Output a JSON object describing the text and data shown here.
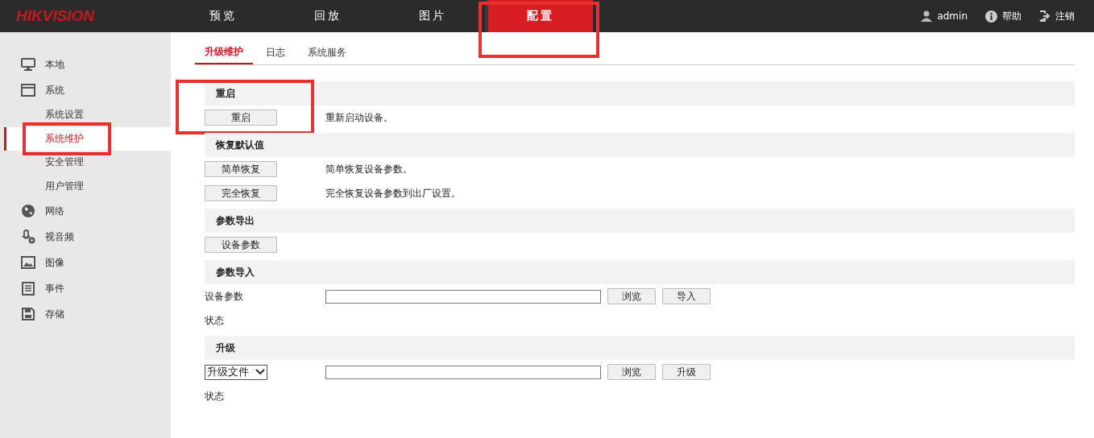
{
  "header": {
    "logo": "HIKVISION",
    "nav": [
      {
        "label": "预览",
        "selected": false
      },
      {
        "label": "回放",
        "selected": false
      },
      {
        "label": "图片",
        "selected": false
      },
      {
        "label": "配置",
        "selected": true,
        "highlighted": true
      }
    ],
    "user": "admin",
    "help": "帮助",
    "logout": "注销"
  },
  "sidebar": {
    "items": [
      {
        "label": "本地"
      },
      {
        "label": "系统",
        "children": [
          {
            "label": "系统设置",
            "selected": false
          },
          {
            "label": "系统维护",
            "selected": true,
            "highlighted": true
          },
          {
            "label": "安全管理",
            "selected": false
          },
          {
            "label": "用户管理",
            "selected": false
          }
        ]
      },
      {
        "label": "网络"
      },
      {
        "label": "视音频"
      },
      {
        "label": "图像"
      },
      {
        "label": "事件"
      },
      {
        "label": "存储"
      }
    ]
  },
  "tabs": [
    {
      "label": "升级维护",
      "selected": true
    },
    {
      "label": "日志",
      "selected": false
    },
    {
      "label": "系统服务",
      "selected": false
    }
  ],
  "sections": [
    {
      "title": "重启",
      "highlighted": true,
      "rows": [
        {
          "kind": "button",
          "button": "重启",
          "description": "重新启动设备。"
        }
      ]
    },
    {
      "title": "恢复默认值",
      "rows": [
        {
          "kind": "button",
          "button": "简单恢复",
          "description": "简单恢复设备参数。"
        },
        {
          "kind": "button",
          "button": "完全恢复",
          "description": "完全恢复设备参数到出厂设置。"
        }
      ]
    },
    {
      "title": "参数导出",
      "rows": [
        {
          "kind": "button",
          "button": "设备参数"
        }
      ]
    },
    {
      "title": "参数导入",
      "rows": [
        {
          "kind": "file",
          "label": "设备参数",
          "browse": "浏览",
          "action": "导入"
        },
        {
          "kind": "status",
          "label": "状态"
        }
      ]
    },
    {
      "title": "升级",
      "rows": [
        {
          "kind": "select-file",
          "select": "升级文件",
          "browse": "浏览",
          "action": "升级"
        },
        {
          "kind": "status",
          "label": "状态"
        }
      ]
    }
  ]
}
